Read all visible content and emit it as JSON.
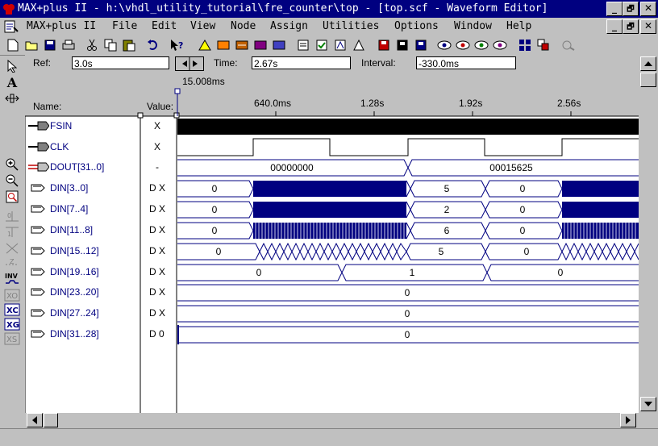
{
  "window": {
    "title": "MAX+plus II - h:\\vhdl_utility_tutorial\\fre_counter\\top - [top.scf - Waveform Editor]",
    "min_label": "_",
    "restore_label": "🗗",
    "close_label": "✕"
  },
  "menu": {
    "app": "MAX+plus II",
    "items": [
      "File",
      "Edit",
      "View",
      "Node",
      "Assign",
      "Utilities",
      "Options",
      "Window",
      "Help"
    ]
  },
  "header": {
    "ref_label": "Ref:",
    "ref_value": "3.0s",
    "time_label": "Time:",
    "time_value": "2.67s",
    "interval_label": "Interval:",
    "interval_value": "-330.0ms",
    "cursor_time": "15.008ms",
    "name_col": "Name:",
    "value_col": "Value:",
    "ticks": [
      "640.0ms",
      "1.28s",
      "1.92s",
      "2.56s"
    ]
  },
  "signals": [
    {
      "name": "FSIN",
      "value": "X",
      "kind": "input"
    },
    {
      "name": "CLK",
      "value": "X",
      "kind": "input"
    },
    {
      "name": "DOUT[31..0]",
      "value": "-",
      "kind": "output-bus",
      "segments": [
        "00000000",
        "00015625"
      ]
    },
    {
      "name": "DIN[3..0]",
      "value": "D X",
      "kind": "bus",
      "segments": [
        "0",
        "5",
        "0"
      ]
    },
    {
      "name": "DIN[7..4]",
      "value": "D X",
      "kind": "bus",
      "segments": [
        "0",
        "2",
        "0"
      ]
    },
    {
      "name": "DIN[11..8]",
      "value": "D X",
      "kind": "bus",
      "segments": [
        "0",
        "6",
        "0"
      ]
    },
    {
      "name": "DIN[15..12]",
      "value": "D X",
      "kind": "bus",
      "segments": [
        "0",
        "5",
        "0"
      ]
    },
    {
      "name": "DIN[19..16]",
      "value": "D X",
      "kind": "bus",
      "segments": [
        "0",
        "1",
        "0"
      ]
    },
    {
      "name": "DIN[23..20]",
      "value": "D X",
      "kind": "bus",
      "segments": [
        "0"
      ]
    },
    {
      "name": "DIN[27..24]",
      "value": "D X",
      "kind": "bus",
      "segments": [
        "0"
      ]
    },
    {
      "name": "DIN[31..28]",
      "value": "D 0",
      "kind": "bus",
      "segments": [
        "0"
      ]
    }
  ],
  "colors": {
    "title_bg": "#000080",
    "wave_fill": "#000080",
    "signal_name": "#000080"
  }
}
